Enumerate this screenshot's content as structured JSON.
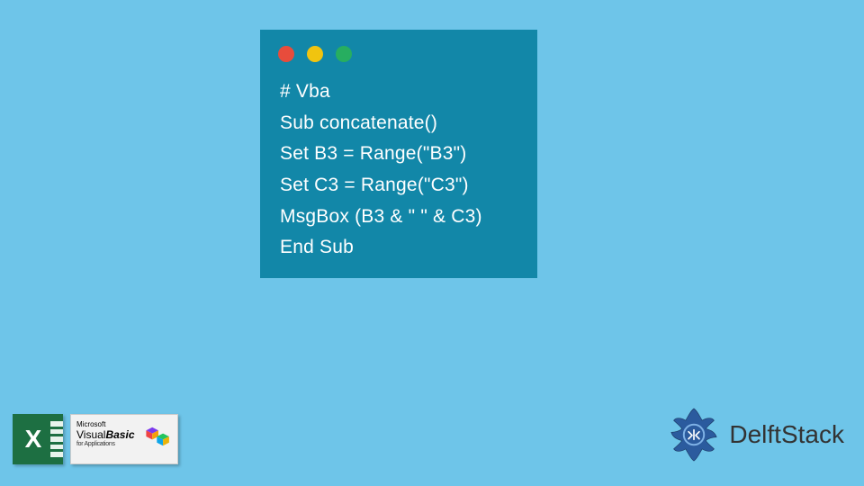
{
  "code_window": {
    "traffic_lights": [
      "red",
      "yellow",
      "green"
    ],
    "lines": [
      "# Vba",
      "Sub concatenate()",
      "Set B3 = Range(\"B3\")",
      "Set C3 = Range(\"C3\")",
      "MsgBox (B3 & \" \" & C3)",
      "End Sub"
    ]
  },
  "excel_badge": {
    "letter": "X",
    "microsoft": "Microsoft",
    "visual": "Visual",
    "basic": "Basic",
    "for_apps": "for Applications"
  },
  "delft": {
    "name": "DelftStack"
  },
  "colors": {
    "background": "#6ec5e9",
    "window": "#1287a8",
    "code_text": "#ffffff",
    "delft_blue": "#2b5b9e",
    "delft_dark": "#1d3a66",
    "excel_green": "#1d6f42"
  }
}
